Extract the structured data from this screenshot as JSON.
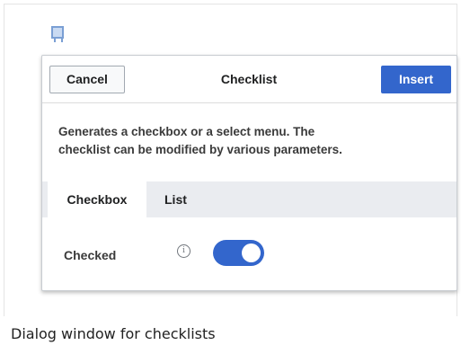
{
  "dialog": {
    "cancel_label": "Cancel",
    "title": "Checklist",
    "insert_label": "Insert",
    "description_line1": "Generates a checkbox or a select menu. The",
    "description_line2": "checklist can be modified by various parameters.",
    "tabs": [
      {
        "label": "Checkbox",
        "selected": true
      },
      {
        "label": "List",
        "selected": false
      }
    ],
    "field": {
      "label": "Checked",
      "info_icon": "info-icon",
      "value": true
    }
  },
  "widget_icon": "checklist-widget-icon",
  "caption": "Dialog window for checklists",
  "colors": {
    "accent": "#3366cc",
    "tab_bar": "#eaecf0"
  }
}
